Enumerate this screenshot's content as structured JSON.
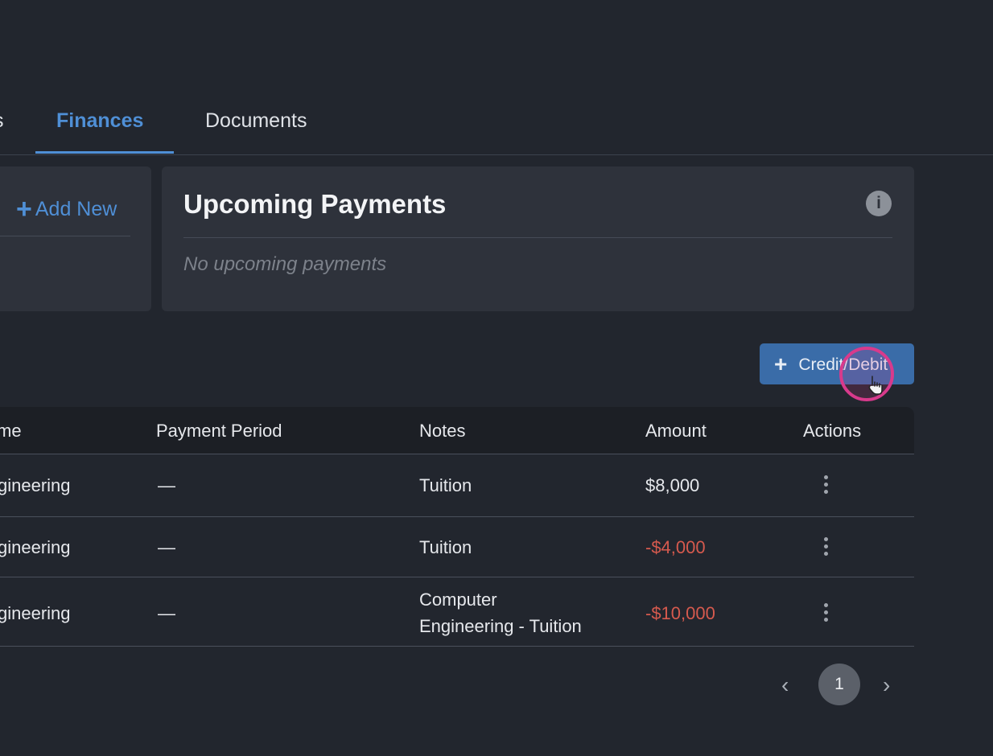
{
  "tabs": [
    {
      "label": "s"
    },
    {
      "label": "Finances",
      "active": true
    },
    {
      "label": "Documents"
    }
  ],
  "left_card": {
    "add_new_label": "Add New",
    "icon": "plus-icon"
  },
  "upcoming_payments": {
    "title": "Upcoming Payments",
    "info_icon": "i",
    "empty_message": "No upcoming payments"
  },
  "credit_debit_button": {
    "label": "Credit/Debit",
    "icon": "plus-icon"
  },
  "table": {
    "columns": [
      "me",
      "Payment Period",
      "Notes",
      "Amount",
      "Actions"
    ],
    "rows": [
      {
        "name": "gineering",
        "period": "—",
        "notes": "Tuition",
        "notes_line2": "",
        "amount": "$8,000",
        "negative": false
      },
      {
        "name": "gineering",
        "period": "—",
        "notes": "Tuition",
        "notes_line2": "",
        "amount": "-$4,000",
        "negative": true
      },
      {
        "name": "gineering",
        "period": "—",
        "notes": "Computer",
        "notes_line2": "Engineering - Tuition",
        "amount": "-$10,000",
        "negative": true
      }
    ]
  },
  "pagination": {
    "prev": "‹",
    "current_page": "1",
    "next": "›"
  },
  "colors": {
    "accent": "#4f8fd6",
    "negative": "#d65a4e",
    "button": "#3a6ca8",
    "background": "#22262e",
    "card": "#2e323b"
  }
}
